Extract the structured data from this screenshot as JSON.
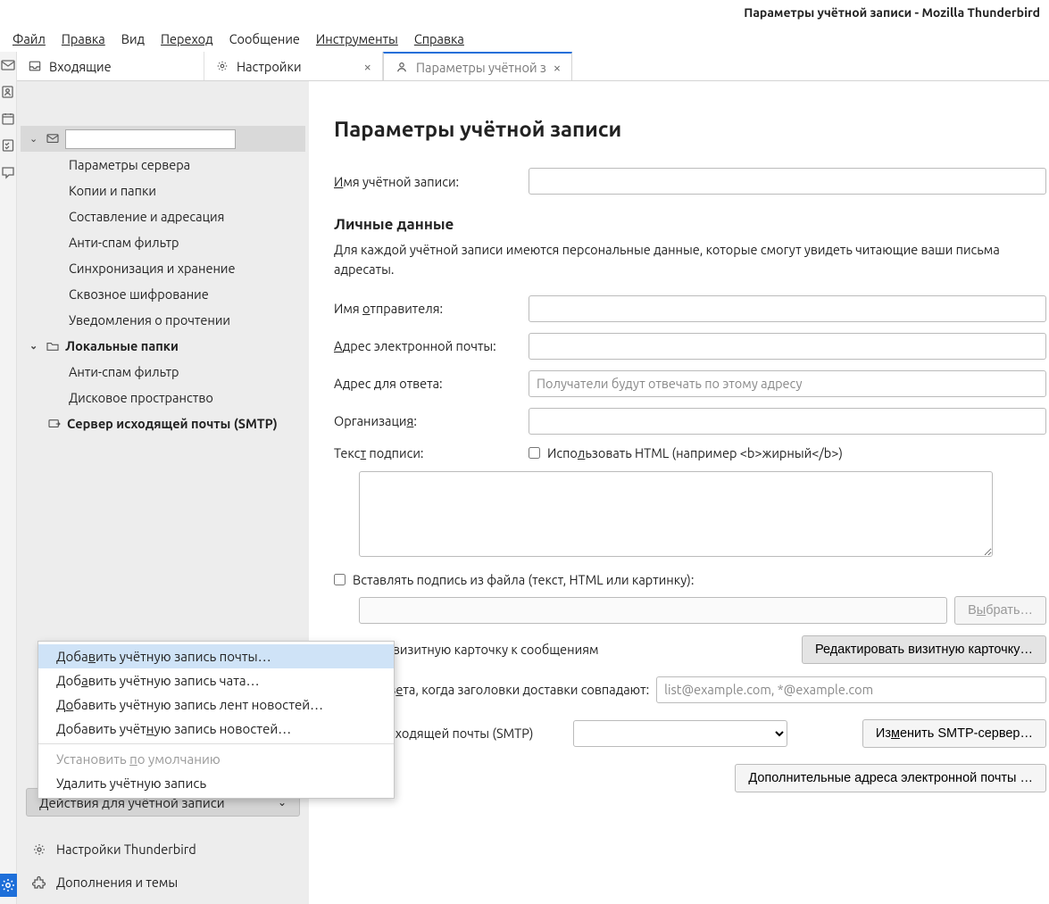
{
  "window": {
    "title": "Параметры учётной записи - Mozilla Thunderbird"
  },
  "menubar": {
    "file": "Файл",
    "edit": "Правка",
    "view": "Вид",
    "go": "Переход",
    "message": "Сообщение",
    "tools": "Инструменты",
    "help": "Справка"
  },
  "tabs": {
    "inbox": "Входящие",
    "settings": "Настройки",
    "account": "Параметры учётной з"
  },
  "tree": {
    "account_items": [
      "Параметры сервера",
      "Копии и папки",
      "Составление и адресация",
      "Анти-спам фильтр",
      "Синхронизация и хранение",
      "Сквозное шифрование",
      "Уведомления о прочтении"
    ],
    "local_label": "Локальные папки",
    "local_items": [
      "Анти-спам фильтр",
      "Дисковое пространство"
    ],
    "smtp_label": "Сервер исходящей почты (SMTP)"
  },
  "popup": {
    "add_mail": "Добавить учётную запись почты…",
    "add_chat": "Добавить учётную запись чата…",
    "add_feed": "Добавить учётную запись лент новостей…",
    "add_news": "Добавить учётную запись новостей…",
    "set_default": "Установить по умолчанию",
    "delete": "Удалить учётную запись"
  },
  "sidebar": {
    "actions_label": "Действия для учётной записи",
    "settings_link": "Настройки Thunderbird",
    "addons_link": "Дополнения и темы"
  },
  "form": {
    "title": "Параметры учётной записи",
    "acct_name_label": "Имя учётной записи:",
    "section_personal": "Личные данные",
    "section_desc": "Для каждой учётной записи имеются персональные данные, которые смогут увидеть читающие ваши письма адресаты.",
    "sender_label": "Имя отправителя:",
    "email_label": "Адрес электронной почты:",
    "reply_label": "Адрес для ответа:",
    "reply_placeholder": "Получатели будут отвечать по этому адресу",
    "org_label": "Организация:",
    "sig_label": "Текст подписи:",
    "sig_html_label": "Использовать HTML (например <b>жирный</b>)",
    "sig_file_label": "Вставлять подпись из файла (текст, HTML или картинку):",
    "browse_btn": "Выбрать…",
    "vcard_label": "крепля́ть визитную карточку к сообщениям",
    "vcard_btn": "Редактировать визитную карточку…",
    "reply_match_label": "ес для ответа, когда заголовки доставки совпадают:",
    "reply_match_placeholder": "list@example.com, *@example.com",
    "smtp_label": "Сервер исходящей почты (SMTP)",
    "smtp_btn": "Изменить SMTP-сервер…",
    "extra_btn": "Дополнительные адреса электронной почты …"
  }
}
